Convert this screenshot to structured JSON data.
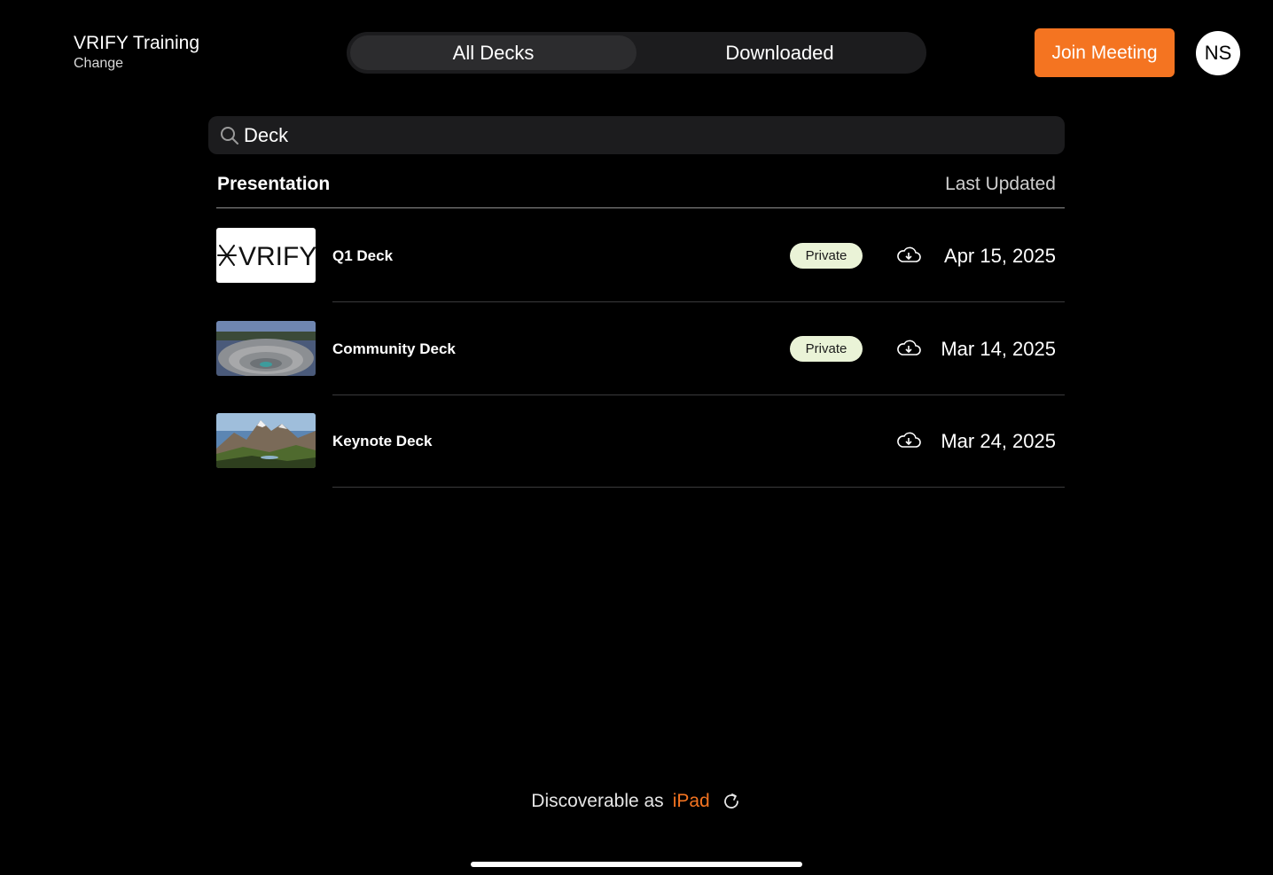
{
  "header": {
    "workspace_name": "VRIFY Training",
    "workspace_action": "Change",
    "tabs": [
      {
        "label": "All Decks",
        "active": true
      },
      {
        "label": "Downloaded",
        "active": false
      }
    ],
    "join_label": "Join Meeting",
    "avatar_initials": "NS"
  },
  "search": {
    "value": "Deck",
    "icon": "search-icon"
  },
  "table": {
    "columns": {
      "presentation": "Presentation",
      "updated": "Last Updated"
    },
    "rows": [
      {
        "title": "Q1 Deck",
        "badge": "Private",
        "date": "Apr 15, 2025",
        "thumbnail": "vrify-logo",
        "thumbnail_text": "VRIFY"
      },
      {
        "title": "Community Deck",
        "badge": "Private",
        "date": "Mar 14, 2025",
        "thumbnail": "open-pit-mine-photo"
      },
      {
        "title": "Keynote Deck",
        "date": "Mar 24, 2025",
        "thumbnail": "mountain-landscape-photo"
      }
    ]
  },
  "footer": {
    "prefix": "Discoverable as",
    "device": "iPad",
    "icon": "refresh-icon"
  },
  "colors": {
    "accent": "#f47421",
    "background": "#000000",
    "badge_bg": "#eaf3d7"
  }
}
